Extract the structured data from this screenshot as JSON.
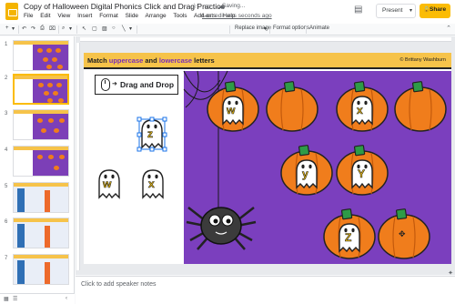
{
  "header": {
    "doc_title": "Copy of Halloween Digital Phonics Click and Drag Practice",
    "star_icon": "☆",
    "folder_icon": "▭",
    "cloud_icon": "☁",
    "saving": "Saving...",
    "menus": [
      "File",
      "Edit",
      "View",
      "Insert",
      "Format",
      "Slide",
      "Arrange",
      "Tools",
      "Add-ons",
      "Help"
    ],
    "last_edit": "Last edit was seconds ago",
    "comment_icon": "▤",
    "present_label": "Present",
    "present_arrow": "▾",
    "share_label": "Share",
    "share_icon": "🔒"
  },
  "toolbar": {
    "add": "+",
    "add_arrow": "▾",
    "undo": "↶",
    "redo": "↷",
    "print": "⎙",
    "paint_format": "⌧",
    "zoom": "⌕",
    "zoom_arrow": "▾",
    "select": "↖",
    "textbox": "▢",
    "image": "▨",
    "shape": "○",
    "line": "╲",
    "line_arrow": "▾",
    "replace_image": "Replace image",
    "replace_arrow": "▾",
    "format_options": "Format options",
    "animate": "Animate",
    "collapse": "⌃"
  },
  "filmstrip": {
    "slide_numbers": [
      "1",
      "2",
      "3",
      "4",
      "5",
      "6",
      "7"
    ],
    "selected_index": 1
  },
  "slide": {
    "title_prefix": "Match ",
    "title_hl1": "uppercase",
    "title_mid": " and ",
    "title_hl2": "lowercase",
    "title_suffix": " letters",
    "credit": "© Brittany Washburn",
    "dnd_label": "Drag and Drop",
    "dnd_arrow": "➜",
    "loose_ghosts": [
      "z",
      "w",
      "x"
    ],
    "pumpkin_ghosts": [
      "w",
      "x",
      "y",
      "Y",
      "Z"
    ],
    "move_cursor": "✥"
  },
  "notes": {
    "placeholder": "Click to add speaker notes"
  },
  "bottom": {
    "grid_icon": "▦",
    "list_icon": "☰",
    "collapse_icon": "‹",
    "explore_icon": "✦"
  },
  "colors": {
    "purple_bg": "#7b3fbe",
    "header_yellow": "#f6c34a",
    "pumpkin_orange": "#f07d1c",
    "stem_green": "#2e9b47",
    "selection_blue": "#1a73e8"
  }
}
